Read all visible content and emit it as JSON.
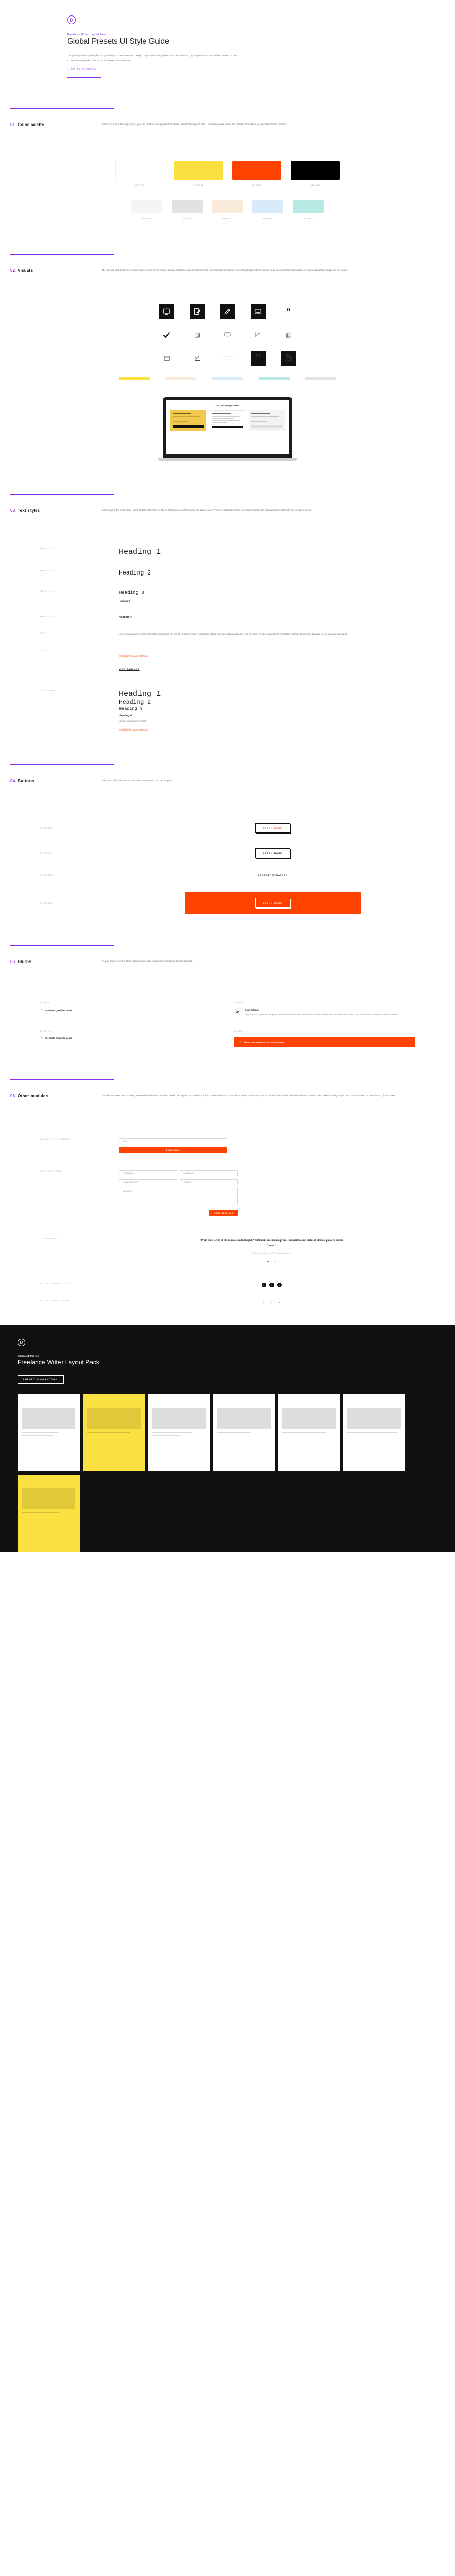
{
  "hero": {
    "logo_letter": "D",
    "eyebrow": "Freelance Writer Layout Pack",
    "title": "Global Presets UI Style Guide",
    "body": "This global presets style guide is a great way to start a new web design project! Wondering how to turn modules into global presets? For a detailed tutorial on how to use this style guide, click on the link below to be redirected.",
    "cta": "→ GO TO TUTORIAL"
  },
  "sections": {
    "color_palette": {
      "number": "01.",
      "title": "Color palette",
      "description": "In the first part of the style guide, you can find the color palette that's been used for the layout pack. Use these colors inside the default color palette in your Divi Theme Options.",
      "row1": [
        {
          "hex": "#FFFFFF",
          "label": "#FFFFFF"
        },
        {
          "hex": "#FBE041",
          "label": "#FBE041"
        },
        {
          "hex": "#FF4200",
          "label": "#FF4200"
        },
        {
          "hex": "#000000",
          "label": "#000000"
        }
      ],
      "row2": [
        {
          "hex": "#F5F5F5",
          "label": "#F5F5F5"
        },
        {
          "hex": "#E2E2E2",
          "label": "#E2E2E2"
        },
        {
          "hex": "#FAEADA",
          "label": "#FAEADA"
        },
        {
          "hex": "#D7EBFA",
          "label": "#D7EBFA"
        },
        {
          "hex": "#B7E8E4",
          "label": "#B7E8E4"
        }
      ]
    },
    "visuals": {
      "number": "02.",
      "title": "Visuals",
      "description": "The second part of this style guide shares some of the visuals that are included inside the layout pack. By importing the layout to your Divi Library, these visuals have automatically been added to your media library, ready for you to use.",
      "icons_row1": [
        "monitor-icon",
        "clipboard-pencil-icon",
        "pencil-icon",
        "inbox-icon",
        "quote-icon"
      ],
      "icons_row2": [
        "check-icon",
        "copy-icon",
        "monitor-outline-icon",
        "chart-icon",
        "copy-outline-icon"
      ],
      "icons_row3": [
        "browser-window-icon",
        "chart-line-icon",
        "lines-icon",
        "quote-tile-icon",
        "ampersand-tile-icon"
      ],
      "bars": [
        "#FBE041",
        "#FAEADA",
        "#D7EBFA",
        "#B7E8E4",
        "#E2E2E2"
      ],
      "mockup": {
        "title": "Our Consulting Services",
        "card_a_button": "",
        "card_b_button": "",
        "card_c_title": "Branding & Positioning"
      }
    },
    "text_styles": {
      "number": "03.",
      "title": "Text styles",
      "description": "In this part of the style guide, you'll find the different text styles that were used throughout the layout pack. There's a separate preset for each heading style and a global preset with all text styles in one.",
      "rows": [
        {
          "label": "HEADING 1",
          "sample": "Heading 1"
        },
        {
          "label": "HEADING 2",
          "sample": "Heading 2"
        },
        {
          "label": "HEADING 3",
          "sample": "Heading 3",
          "sub": "Heading 3"
        },
        {
          "label": "HEADING 4",
          "sample": "Heading 4"
        },
        {
          "label": "BODY",
          "sample": "Lorem ipsum dolor sit amet, consectetur adipiscing elit, sed do eiusmod tempor incididunt ut labore et dolore magna aliqua. Ut enim ad minim veniam, quis nostrud exercitation ullamco laboris nisi ut aliquip ex ea commodo consequat."
        },
        {
          "label": "LINK",
          "sample": "hello@divifreelancewriter.com",
          "sub": "VIEW SAMPLES"
        }
      ],
      "all_in_one": {
        "label": "ALL IN ONE",
        "h1": "Heading 1",
        "h2": "Heading 2",
        "h3": "Heading 3",
        "h4": "Heading 4",
        "body": "Lorum ipsum dolor sit amet.",
        "link": "hello@divifreelancewriter.com"
      }
    },
    "buttons": {
      "number": "04.",
      "title": "Buttons",
      "description": "Here, you'll find the buttons that have been used in the layout pack.",
      "items": [
        {
          "label": "BUTTON 1",
          "text": "LEARN MORE",
          "style": "outline-orange"
        },
        {
          "label": "BUTTON 2",
          "text": "LEARN MORE",
          "style": "outline-dark"
        },
        {
          "label": "BUTTON 3",
          "text": "CONTENT STRATEGY",
          "style": "plain"
        },
        {
          "label": "BUTTON 2",
          "text": "LEARN MORE",
          "style": "banner"
        }
      ]
    },
    "blurbs": {
      "number": "05.",
      "title": "Blurbs",
      "description": "As you can see, some blurb modules have also been used throughout this layout pack.",
      "items": [
        {
          "label": "BLURB 1",
          "text": "Generate Qualified Leads",
          "style": "check-orange"
        },
        {
          "label": "BLURB 2",
          "title": "Copywriting",
          "text": "Proin lectus ex, finibus sed mi quam, rutrum tincidunt sem, sed non neque leo. Etiam molestie odio consectetur amet enim. Nunc ultrices porta scelerisque ultrices, in eu orci.",
          "style": "card"
        },
        {
          "label": "BLURB 3",
          "text": "Generate Qualified Leads",
          "style": "check-dark"
        },
        {
          "label": "BLURB 4",
          "text": "Reach your readers in their own language",
          "style": "orange-bar"
        }
      ]
    },
    "other_modules": {
      "number": "06.",
      "title": "Other modules",
      "description": "Last but not least, we're sharing some other modules that were used in the layout pack. Here, you'll find the email opt-in form, contact form, testimonial, social media follow and social media share modules. Divi makes it really easy to turn each of these modules into a global preset.",
      "email_optin": {
        "label": "EMAIL OPTIN MODULE",
        "field_placeholder": "Email",
        "submit_label": "SUBSCRIBE"
      },
      "contact_form": {
        "label": "CONTACT FORM",
        "first_name": "FIRST NAME",
        "last_name": "LAST NAME",
        "email_address": "EMAIL ADDRESS",
        "subject": "SUBJECT",
        "message": "MESSAGE",
        "submit_label": "SEND MESSAGE"
      },
      "testimonial": {
        "label": "TESTIMONIAL",
        "quote": "\"Proin quis lorem ut libero malesuada feugiat. Vestibulum ante ipsum primis in faucibus orci luctus et ultrices posuere cubilia Curae.\"",
        "author": "Robert Smith - CEO Adam Adams"
      },
      "social_follow": {
        "label": "SOCIAL MEDIA FOLLOW",
        "icons": [
          "facebook-icon",
          "twitter-icon",
          "instagram-icon"
        ]
      },
      "social_share": {
        "label": "SOCIAL MEDIA SHARE",
        "icons": [
          "facebook-icon",
          "twitter-icon",
          "pinterest-icon"
        ]
      }
    }
  },
  "footer": {
    "logo_letter": "D",
    "eyebrow": "Check out this free",
    "title": "Freelance Writer Layout Pack",
    "button": "I WANT THIS LAYOUT PACK"
  }
}
